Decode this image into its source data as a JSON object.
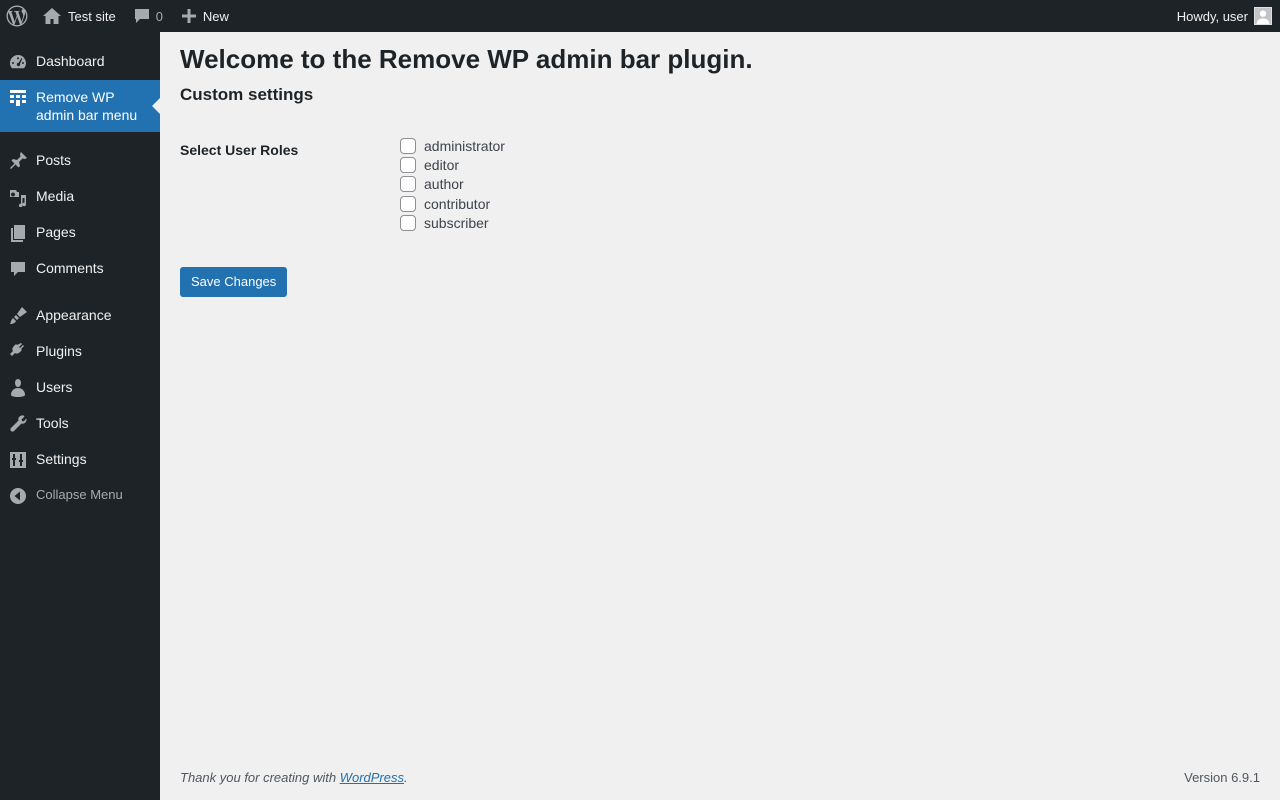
{
  "adminbar": {
    "site_name": "Test site",
    "comments_count": "0",
    "new_label": "New",
    "howdy": "Howdy, user"
  },
  "sidebar": {
    "items": [
      {
        "label": "Dashboard",
        "icon": "dashboard-icon"
      },
      {
        "label": "Remove WP admin bar menu",
        "icon": "grid-icon"
      },
      {
        "label": "Posts",
        "icon": "pin-icon"
      },
      {
        "label": "Media",
        "icon": "media-icon"
      },
      {
        "label": "Pages",
        "icon": "pages-icon"
      },
      {
        "label": "Comments",
        "icon": "comment-icon"
      },
      {
        "label": "Appearance",
        "icon": "brush-icon"
      },
      {
        "label": "Plugins",
        "icon": "plugin-icon"
      },
      {
        "label": "Users",
        "icon": "user-icon"
      },
      {
        "label": "Tools",
        "icon": "wrench-icon"
      },
      {
        "label": "Settings",
        "icon": "settings-icon"
      }
    ],
    "collapse_label": "Collapse Menu"
  },
  "main": {
    "title": "Welcome to the Remove WP admin bar plugin.",
    "subtitle": "Custom settings",
    "roles_label": "Select User Roles",
    "roles": [
      "administrator",
      "editor",
      "author",
      "contributor",
      "subscriber"
    ],
    "save_label": "Save Changes"
  },
  "footer": {
    "thanks_prefix": "Thank you for creating with ",
    "link_text": "WordPress",
    "thanks_suffix": ".",
    "version": "Version 6.9.1"
  },
  "colors": {
    "bar_bg": "#1d2327",
    "accent": "#2271b1",
    "page_bg": "#f0f0f1"
  }
}
